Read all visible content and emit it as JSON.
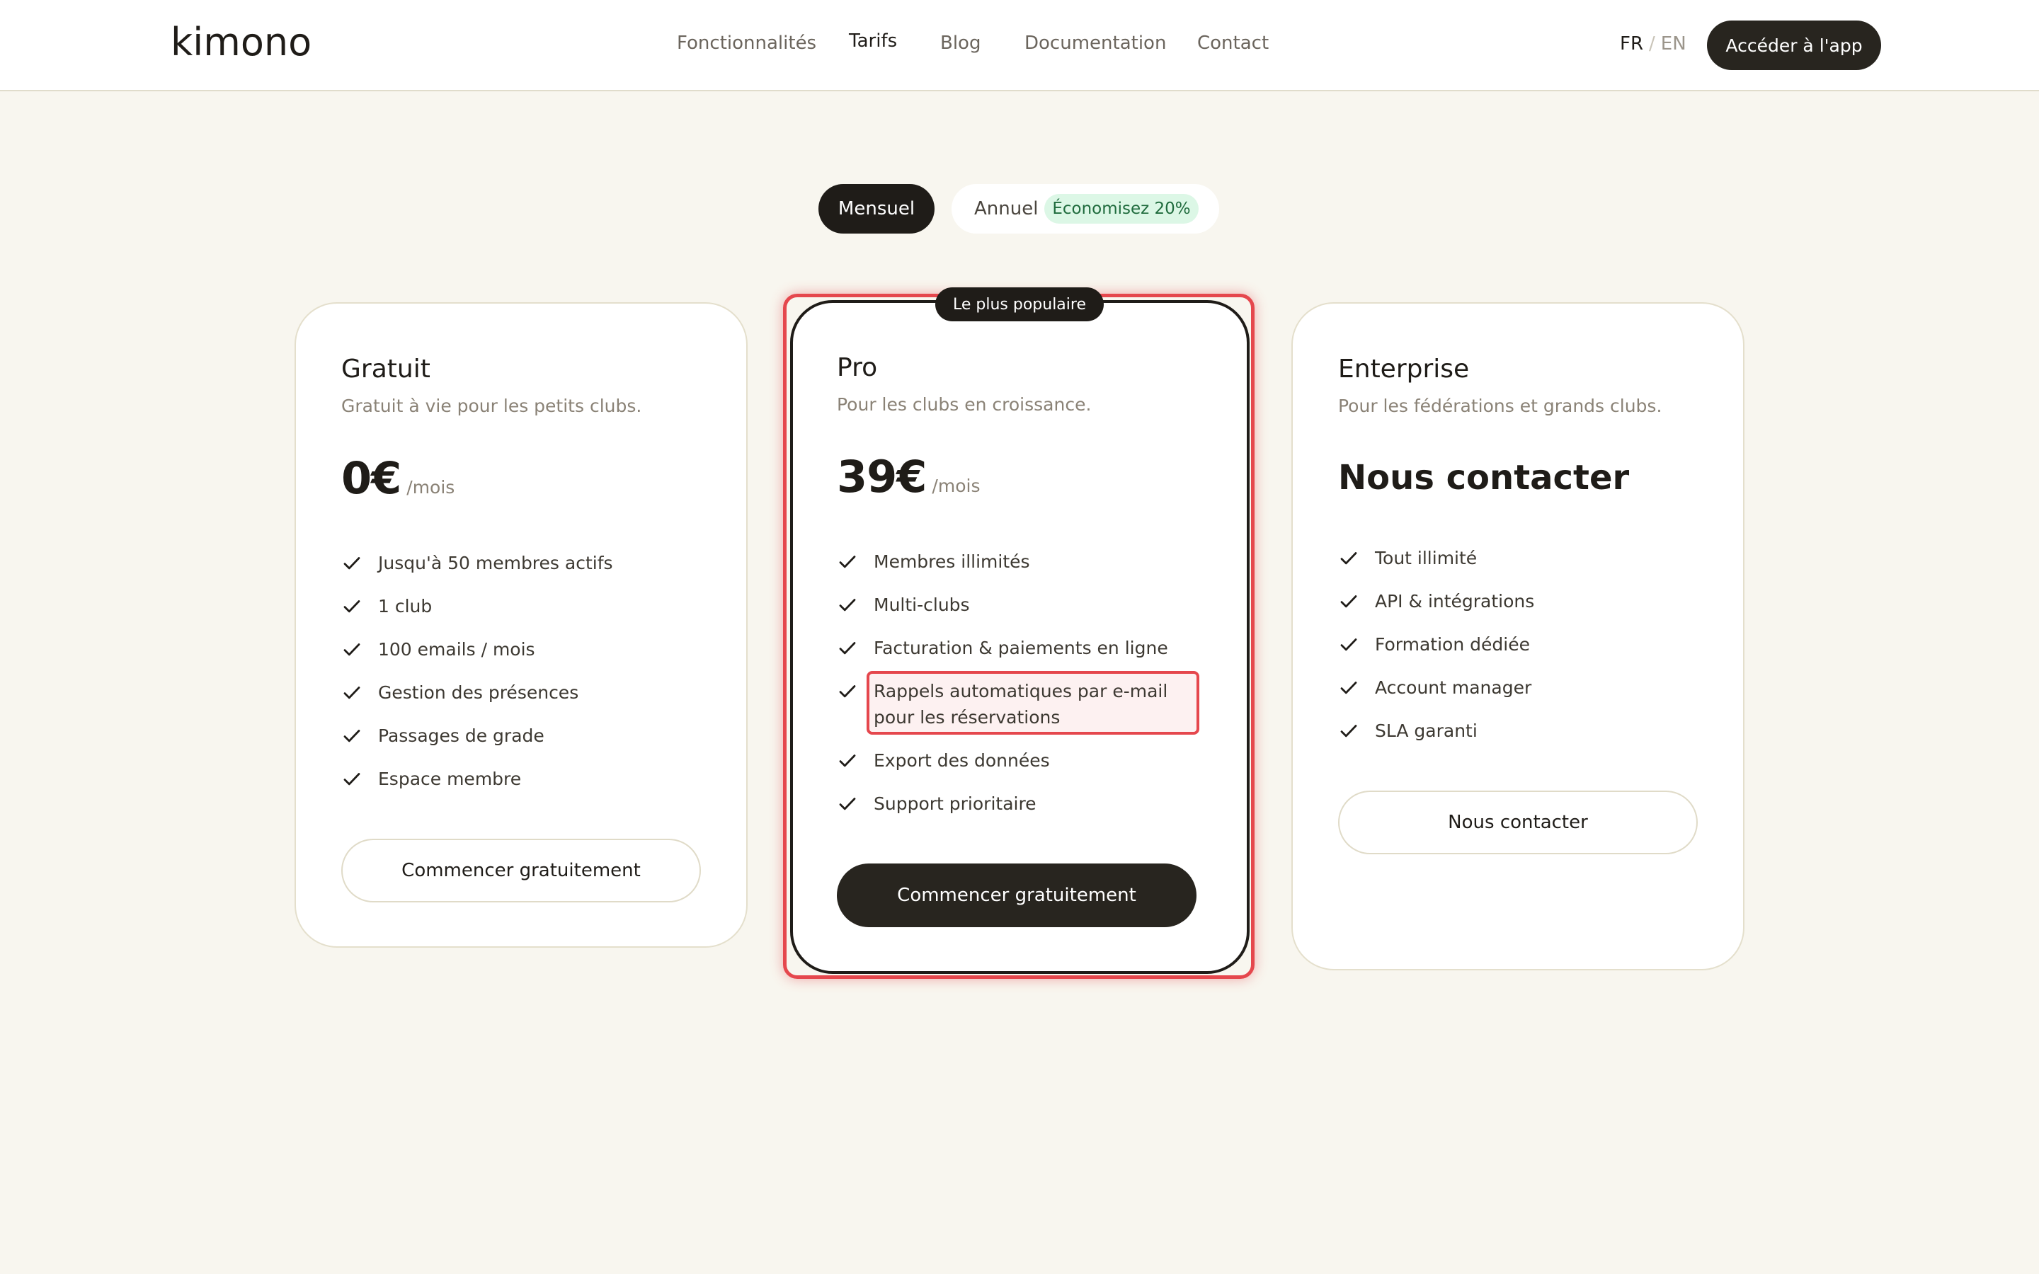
{
  "header": {
    "logo": "kimono",
    "nav": [
      {
        "label": "Fonctionnalités"
      },
      {
        "label": "Tarifs"
      },
      {
        "label": "Blog"
      },
      {
        "label": "Documentation"
      },
      {
        "label": "Contact"
      }
    ],
    "lang": {
      "fr": "FR",
      "sep": "/",
      "en": "EN"
    },
    "app_button": "Accéder à l'app"
  },
  "billing": {
    "monthly": "Mensuel",
    "annual": "Annuel",
    "save_badge": "Économisez 20%"
  },
  "plans": {
    "free": {
      "title": "Gratuit",
      "desc": "Gratuit à vie pour les petits clubs.",
      "price": "0€",
      "period": "/mois",
      "features": [
        "Jusqu'à 50 membres actifs",
        "1 club",
        "100 emails / mois",
        "Gestion des présences",
        "Passages de grade",
        "Espace membre"
      ],
      "cta": "Commencer gratuitement"
    },
    "pro": {
      "badge": "Le plus populaire",
      "title": "Pro",
      "desc": "Pour les clubs en croissance.",
      "price": "39€",
      "period": "/mois",
      "features": [
        "Membres illimités",
        "Multi-clubs",
        "Facturation & paiements en ligne",
        "Rappels automatiques par e-mail pour les réservations",
        "Export des données",
        "Support prioritaire"
      ],
      "cta": "Commencer gratuitement"
    },
    "enterprise": {
      "title": "Enterprise",
      "desc": "Pour les fédérations et grands clubs.",
      "price": "Nous contacter",
      "features": [
        "Tout illimité",
        "API & intégrations",
        "Formation dédiée",
        "Account manager",
        "SLA garanti"
      ],
      "cta": "Nous contacter"
    }
  },
  "colors": {
    "page_bg": "#f8f6ef",
    "dark": "#1f1c18",
    "highlight": "#e5474d",
    "save_badge_bg": "#dcf7e6"
  },
  "icons": {
    "feature_check": "check-icon"
  }
}
